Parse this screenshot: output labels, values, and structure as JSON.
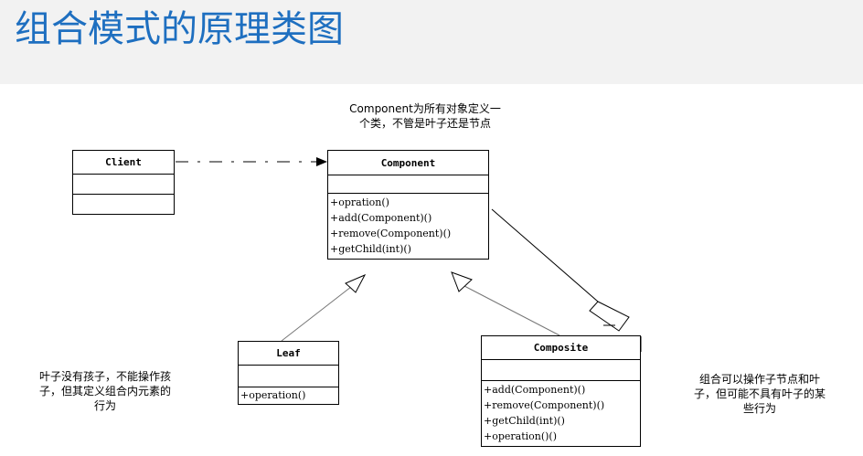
{
  "header": {
    "title": "组合模式的原理类图"
  },
  "classes": {
    "client": {
      "name": "Client"
    },
    "component": {
      "name": "Component",
      "ops": [
        "+opration()",
        "+add(Component)()",
        "+remove(Component)()",
        "+getChild(int)()"
      ]
    },
    "leaf": {
      "name": "Leaf",
      "ops": [
        "+operation()"
      ]
    },
    "composite": {
      "name": "Composite",
      "ops": [
        "+add(Component)()",
        "+remove(Component)()",
        "+getChild(int)()",
        "+operation()()"
      ]
    }
  },
  "notes": {
    "component_line1": "Component为所有对象定义一",
    "component_line2": "个类，不管是叶子还是节点",
    "leaf_line1": "叶子没有孩子，不能操作孩",
    "leaf_line2": "子，但其定义组合内元素的",
    "leaf_line3": "行为",
    "composite_line1": "组合可以操作子节点和叶",
    "composite_line2": "子，但可能不具有叶子的某",
    "composite_line3": "些行为"
  }
}
